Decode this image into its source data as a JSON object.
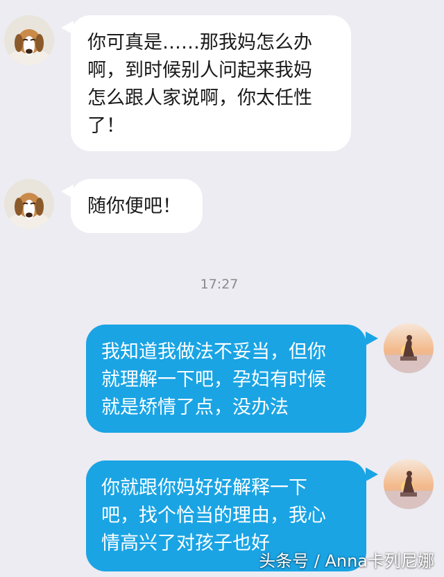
{
  "conversation": {
    "messages": [
      {
        "sender": "other",
        "avatar_icon": "dog-avatar-icon",
        "lines": [
          "你可真是……那我妈怎么办",
          "啊，到时候别人问起来我妈",
          "怎么跟人家说啊，你太任性",
          "了！"
        ]
      },
      {
        "sender": "other",
        "avatar_icon": "dog-avatar-icon",
        "lines": [
          "随你便吧！"
        ]
      },
      {
        "sender": "self",
        "avatar_icon": "sunset-avatar-icon",
        "lines": [
          "我知道我做法不妥当，但你",
          "就理解一下吧，孕妇有时候",
          "就是矫情了点，没办法"
        ]
      },
      {
        "sender": "self",
        "avatar_icon": "sunset-avatar-icon",
        "lines": [
          "你就跟你妈好好解释一下",
          "吧，找个恰当的理由，我心",
          "情高兴了对孩子也好"
        ]
      }
    ],
    "timestamp": "17:27"
  },
  "watermark": "头条号 / Anna卡列尼娜",
  "colors": {
    "background": "#ececf2",
    "left_bubble": "#ffffff",
    "right_bubble": "#1aa4e4",
    "timestamp_text": "#8a8a8a"
  }
}
